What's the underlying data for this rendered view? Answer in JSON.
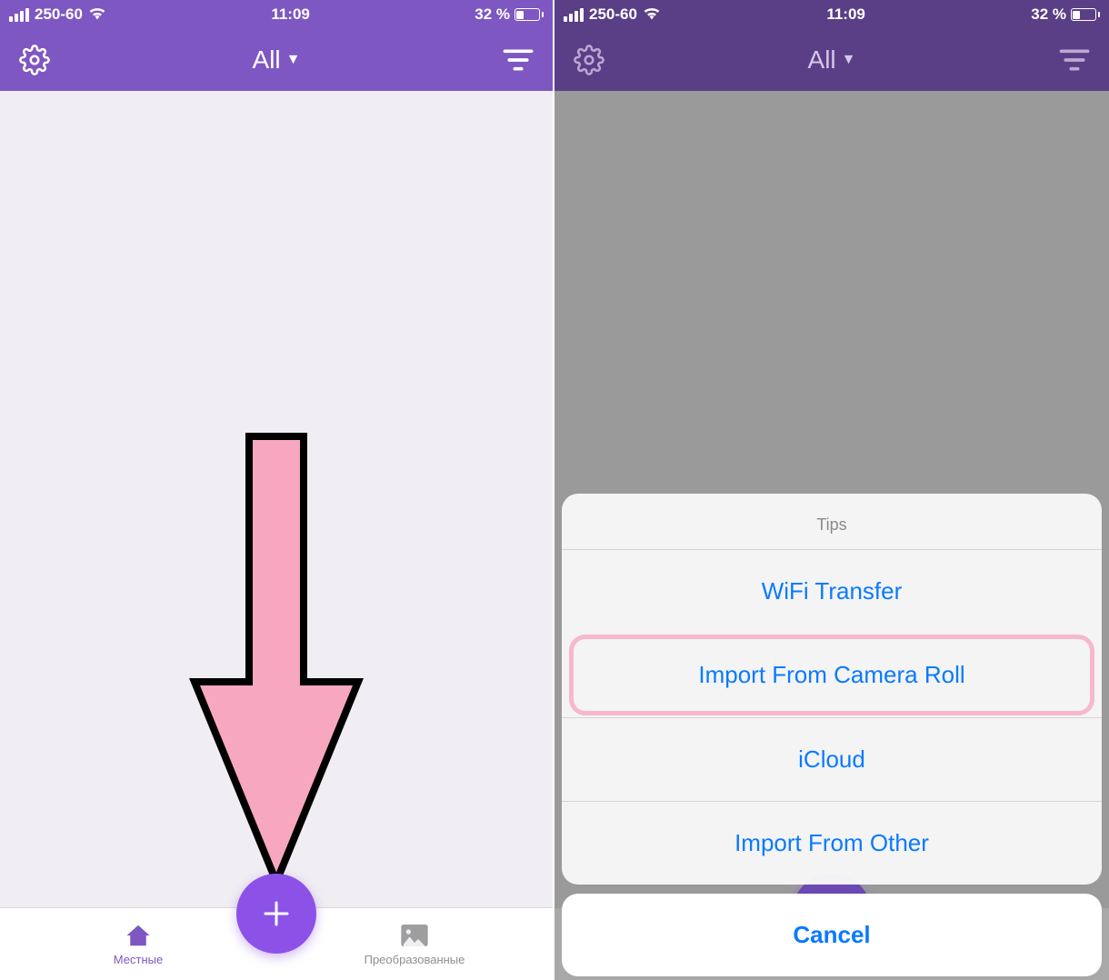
{
  "status_bar": {
    "carrier": "250-60",
    "time": "11:09",
    "battery_pct": "32 %"
  },
  "nav": {
    "title": "All"
  },
  "tabs": {
    "local": "Местные",
    "converted": "Преобразованные"
  },
  "action_sheet": {
    "title": "Tips",
    "options": [
      "WiFi Transfer",
      "Import From Camera Roll",
      "iCloud",
      "Import From Other"
    ],
    "cancel": "Cancel"
  },
  "colors": {
    "primary": "#7e57c2",
    "fab": "#8c52e8",
    "ios_blue": "#0a7aff",
    "highlight": "#f7b8cd",
    "arrow_fill": "#f7a7bf"
  }
}
